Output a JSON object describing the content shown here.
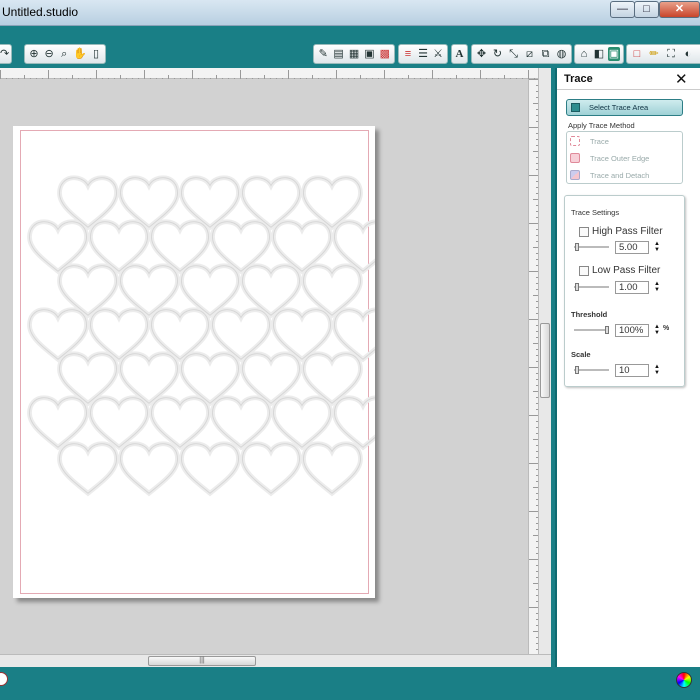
{
  "window": {
    "title": "Untitled.studio",
    "min_label": "—",
    "max_label": "□",
    "close_label": "✕"
  },
  "toolbar": {
    "left_tools": [
      "zoom-in-icon",
      "zoom-out-icon",
      "zoom-select-icon",
      "pan-icon",
      "fit-page-icon"
    ],
    "right_tools": [
      "draw-icon",
      "page-setup-icon",
      "grid-icon",
      "cut-icon",
      "registration-icon",
      "line-style-icon",
      "fill-icon",
      "knife-icon",
      "text-icon",
      "move-icon",
      "rotate-icon",
      "scale-icon",
      "shear-icon",
      "replicate-icon",
      "trace-icon",
      "library-icon",
      "store-icon",
      "trace-selected-icon",
      "rect-icon",
      "pencil-icon",
      "fullscreen-icon",
      "colorwheel-icon"
    ]
  },
  "scroll": {
    "h_thumb_label": "|||"
  },
  "trace_panel": {
    "title": "Trace",
    "close_label": "✕",
    "select_area_label": "Select Trace Area",
    "apply_method_label": "Apply Trace Method",
    "methods": [
      {
        "label": "Trace",
        "icon": "trace-icon"
      },
      {
        "label": "Trace Outer Edge",
        "icon": "trace-outer-edge-icon"
      },
      {
        "label": "Trace and Detach",
        "icon": "trace-detach-icon"
      }
    ],
    "settings_title": "Trace Settings",
    "high_pass": {
      "label": "High Pass Filter",
      "value": "5.00",
      "checked": false
    },
    "low_pass": {
      "label": "Low Pass Filter",
      "value": "1.00",
      "checked": false
    },
    "threshold": {
      "label": "Threshold",
      "value": "100%",
      "unit": "%"
    },
    "scale": {
      "label": "Scale",
      "value": "10"
    }
  },
  "colors": {
    "teal": "#1a7f86",
    "cut_border": "#e4aab4",
    "select_button": "#9fd1d6"
  }
}
